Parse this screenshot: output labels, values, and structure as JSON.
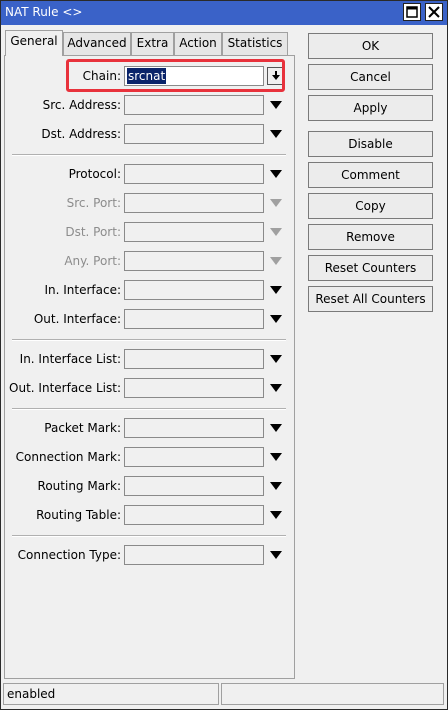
{
  "window": {
    "title": "NAT Rule <>"
  },
  "tabs": [
    {
      "label": "General"
    },
    {
      "label": "Advanced"
    },
    {
      "label": "Extra"
    },
    {
      "label": "Action"
    },
    {
      "label": "Statistics"
    }
  ],
  "form": {
    "chain": {
      "label": "Chain:",
      "value": "srcnat"
    },
    "src_address": {
      "label": "Src. Address:"
    },
    "dst_address": {
      "label": "Dst. Address:"
    },
    "protocol": {
      "label": "Protocol:"
    },
    "src_port": {
      "label": "Src. Port:"
    },
    "dst_port": {
      "label": "Dst. Port:"
    },
    "any_port": {
      "label": "Any. Port:"
    },
    "in_interface": {
      "label": "In. Interface:"
    },
    "out_interface": {
      "label": "Out. Interface:"
    },
    "in_interface_list": {
      "label": "In. Interface List:"
    },
    "out_interface_list": {
      "label": "Out. Interface List:"
    },
    "packet_mark": {
      "label": "Packet Mark:"
    },
    "connection_mark": {
      "label": "Connection Mark:"
    },
    "routing_mark": {
      "label": "Routing Mark:"
    },
    "routing_table": {
      "label": "Routing Table:"
    },
    "connection_type": {
      "label": "Connection Type:"
    }
  },
  "buttons": {
    "ok": "OK",
    "cancel": "Cancel",
    "apply": "Apply",
    "disable": "Disable",
    "comment": "Comment",
    "copy": "Copy",
    "remove": "Remove",
    "reset_counters": "Reset Counters",
    "reset_all_counters": "Reset All Counters"
  },
  "status": {
    "text": "enabled"
  },
  "colors": {
    "highlight": "#e8323c",
    "titlebar": "#3a62c8",
    "selection": "#0a246a"
  }
}
